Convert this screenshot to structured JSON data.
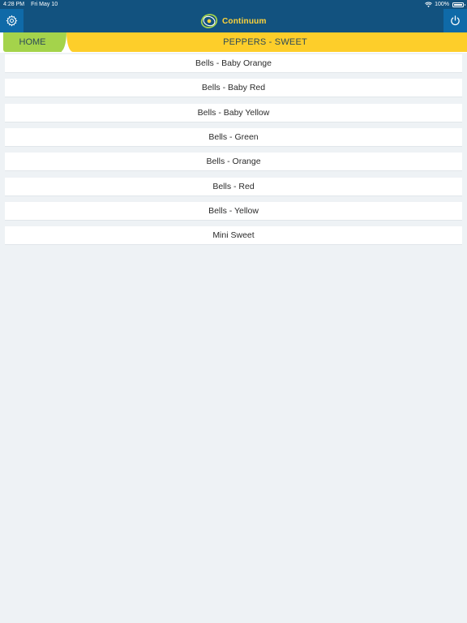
{
  "status_bar": {
    "time": "4:28 PM",
    "date": "Fri May 10",
    "battery": "100%"
  },
  "header": {
    "app_name": "Continuum",
    "icons": {
      "left": "gear-icon",
      "right": "power-icon",
      "logo": "continuum-logo-icon"
    }
  },
  "nav": {
    "home_label": "HOME",
    "section_title": "PEPPERS - SWEET"
  },
  "items": [
    {
      "label": "Bells - Baby Orange"
    },
    {
      "label": "Bells - Baby Red"
    },
    {
      "label": "Bells - Baby Yellow"
    },
    {
      "label": "Bells - Green"
    },
    {
      "label": "Bells - Orange"
    },
    {
      "label": "Bells - Red"
    },
    {
      "label": "Bells - Yellow"
    },
    {
      "label": "Mini Sweet"
    }
  ],
  "colors": {
    "header_bg": "#12527f",
    "header_button_bg": "#0f6aa8",
    "brand_text": "#ffd43b",
    "home_tab": "#a4d34b",
    "section_tab": "#fdce2a",
    "page_bg": "#eef2f5"
  }
}
